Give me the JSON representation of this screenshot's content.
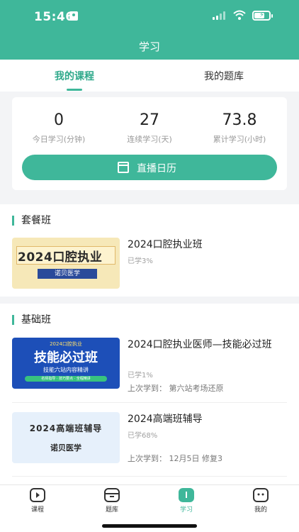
{
  "status_bar": {
    "time": "15:46"
  },
  "header": {
    "title": "学习"
  },
  "tabs": [
    {
      "label": "我的课程",
      "active": true
    },
    {
      "label": "我的题库",
      "active": false
    }
  ],
  "stats": [
    {
      "value": "0",
      "label": "今日学习(分钟)"
    },
    {
      "value": "27",
      "label": "连续学习(天)"
    },
    {
      "value": "73.8",
      "label": "累计学习(小时)"
    }
  ],
  "live_button": {
    "label": "直播日历",
    "icon": "calendar-icon"
  },
  "sections": [
    {
      "title": "套餐班",
      "courses": [
        {
          "title": "2024口腔执业班",
          "progress": "已学3%",
          "thumbnail": {
            "main": "2024口腔执业",
            "sub": "诺贝医学"
          }
        }
      ]
    },
    {
      "title": "基础班",
      "courses": [
        {
          "title": "2024口腔执业医师—技能必过班",
          "progress": "已学1%",
          "last_learned": "上次学到： 第六站考场还原",
          "thumbnail": {
            "top": "2024口腔执业",
            "main": "技能必过班",
            "sub": "技能六站内容精讲",
            "badge": "名师指导 · 技巧要点 · 全程精讲"
          }
        },
        {
          "title": "2024高端班辅导",
          "progress": "已学68%",
          "last_learned": "上次学到： 12月5日 修复3",
          "thumbnail": {
            "main": "2024高端班辅导",
            "sub": "诺贝医学"
          }
        }
      ]
    }
  ],
  "bottom_nav": [
    {
      "label": "课程",
      "icon": "play-icon",
      "active": false
    },
    {
      "label": "题库",
      "icon": "question-bank-icon",
      "active": false
    },
    {
      "label": "学习",
      "icon": "book-icon",
      "active": true
    },
    {
      "label": "我的",
      "icon": "profile-face-icon",
      "active": false
    }
  ],
  "colors": {
    "accent": "#3fb79a",
    "accent_text": "#2fa98b"
  }
}
